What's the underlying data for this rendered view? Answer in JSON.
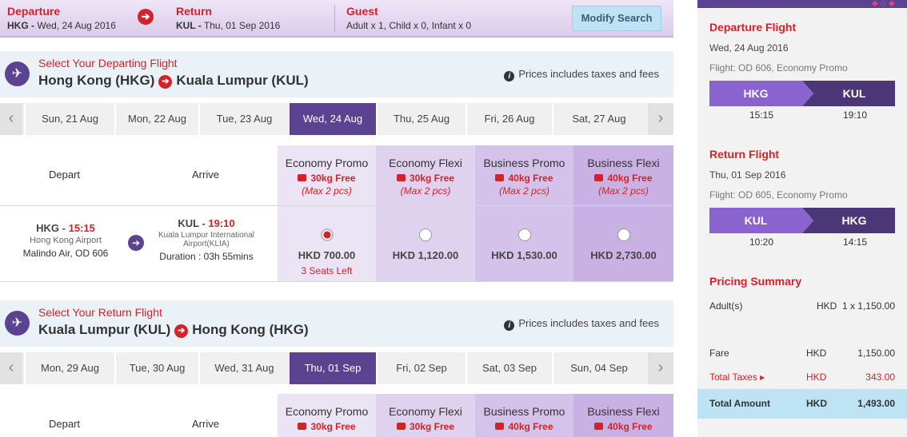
{
  "topbar": {
    "departure": {
      "title": "Departure",
      "code": "HKG -",
      "date": "Wed, 24 Aug 2016"
    },
    "return": {
      "title": "Return",
      "code": "KUL -",
      "date": "Thu, 01 Sep 2016"
    },
    "guest": {
      "title": "Guest",
      "text": "Adult x 1, Child x 0, Infant x 0"
    },
    "modify_label": "Modify Search"
  },
  "departing": {
    "select_label": "Select Your Departing Flight",
    "from": "Hong Kong (HKG)",
    "to": "Kuala Lumpur (KUL)",
    "note": "Prices includes taxes and fees",
    "dates": [
      "Sun, 21 Aug",
      "Mon, 22 Aug",
      "Tue, 23 Aug",
      "Wed, 24 Aug",
      "Thu, 25 Aug",
      "Fri, 26 Aug",
      "Sat, 27 Aug"
    ],
    "selected_date_index": 3,
    "col_depart": "Depart",
    "col_arrive": "Arrive",
    "fares": [
      {
        "name": "Economy Promo",
        "bag": "30kg Free",
        "max": "(Max 2 pcs)",
        "price": "HKD 700.00",
        "seats": "3 Seats Left",
        "selected": true
      },
      {
        "name": "Economy Flexi",
        "bag": "30kg Free",
        "max": "(Max 2 pcs)",
        "price": "HKD 1,120.00",
        "seats": "",
        "selected": false
      },
      {
        "name": "Business Promo",
        "bag": "40kg Free",
        "max": "(Max 2 pcs)",
        "price": "HKD 1,530.00",
        "seats": "",
        "selected": false
      },
      {
        "name": "Business Flexi",
        "bag": "40kg Free",
        "max": "(Max 2 pcs)",
        "price": "HKD 2,730.00",
        "seats": "",
        "selected": false
      }
    ],
    "flight": {
      "dep_code": "HKG - ",
      "dep_time": "15:15",
      "dep_airport": "Hong Kong Airport",
      "carrier": "Malindo Air, OD 606",
      "arr_code": "KUL - ",
      "arr_time": "19:10",
      "arr_airport_1": "Kuala Lumpur International",
      "arr_airport_2": "Airport(KLIA)",
      "duration": "Duration : 03h 55mins"
    }
  },
  "returning": {
    "select_label": "Select Your Return Flight",
    "from": "Kuala Lumpur (KUL)",
    "to": "Hong Kong (HKG)",
    "note": "Prices includes taxes and fees",
    "dates": [
      "Mon, 29 Aug",
      "Tue, 30 Aug",
      "Wed, 31 Aug",
      "Thu, 01 Sep",
      "Fri, 02 Sep",
      "Sat, 03 Sep",
      "Sun, 04 Sep"
    ],
    "selected_date_index": 3,
    "col_depart": "Depart",
    "col_arrive": "Arrive",
    "fares": [
      {
        "name": "Economy Promo",
        "bag": "30kg Free"
      },
      {
        "name": "Economy Flexi",
        "bag": "30kg Free"
      },
      {
        "name": "Business Promo",
        "bag": "40kg Free"
      },
      {
        "name": "Business Flexi",
        "bag": "40kg Free"
      }
    ]
  },
  "panel": {
    "dep_title": "Departure Flight",
    "dep_date": "Wed, 24 Aug 2016",
    "dep_flight": "Flight: OD 606, Economy Promo",
    "dep_from": "HKG",
    "dep_to": "KUL",
    "dep_t1": "15:15",
    "dep_t2": "19:10",
    "ret_title": "Return Flight",
    "ret_date": "Thu, 01 Sep 2016",
    "ret_flight": "Flight: OD 605, Economy Promo",
    "ret_from": "KUL",
    "ret_to": "HKG",
    "ret_t1": "10:20",
    "ret_t2": "14:15",
    "pricing_title": "Pricing Summary",
    "adult_label": "Adult(s)",
    "adult_value": "HKD  1 x 1,150.00",
    "fare_label": "Fare",
    "fare_cur": "HKD",
    "fare_value": "1,150.00",
    "tax_label": "Total Taxes ▸",
    "tax_cur": "HKD",
    "tax_value": "343.00",
    "total_label": "Total Amount",
    "total_cur": "HKD",
    "total_value": "1,493.00"
  },
  "colors": {
    "brand_purple": "#5c4391",
    "accent_red": "#d2232a",
    "total_blue": "#bde3f5"
  }
}
